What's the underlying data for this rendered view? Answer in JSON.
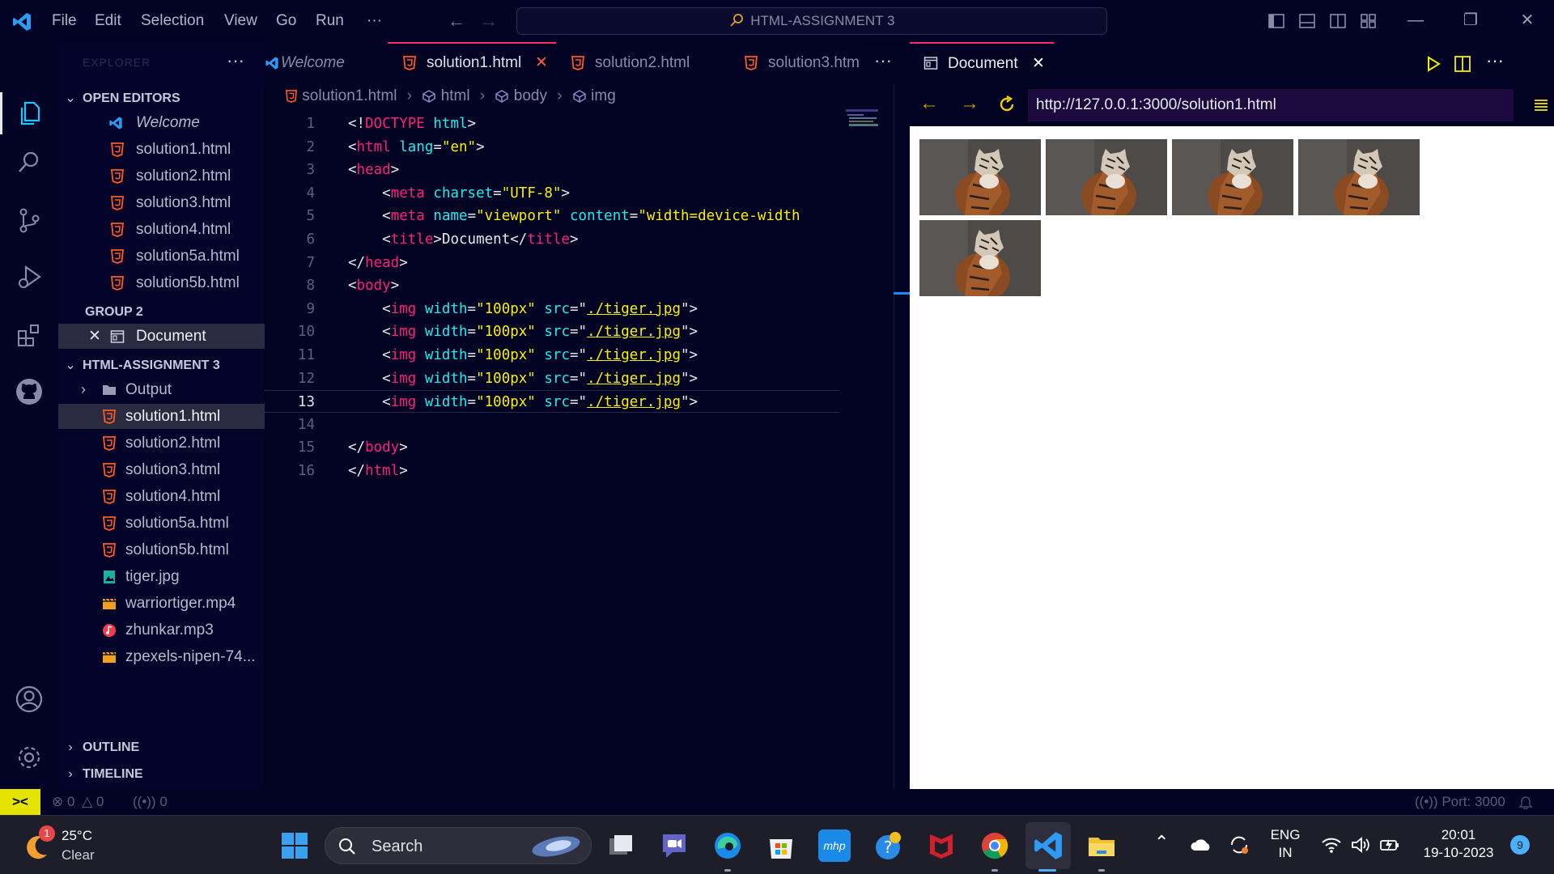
{
  "menu": [
    "File",
    "Edit",
    "Selection",
    "View",
    "Go",
    "Run",
    "···"
  ],
  "command_center": "HTML-ASSIGNMENT 3",
  "window_controls": {
    "minimize": "—",
    "restore": "❐",
    "close": "✕"
  },
  "sidebar": {
    "title": "EXPLORER",
    "more": "···",
    "open_editors_header": "OPEN EDITORS",
    "open_editors": [
      "Welcome",
      "solution1.html",
      "solution2.html",
      "solution3.html",
      "solution4.html",
      "solution5a.html",
      "solution5b.html"
    ],
    "group_header": "GROUP 2",
    "group_item": "Document",
    "folder_header": "HTML-ASSIGNMENT 3",
    "folder_items": [
      "Output",
      "solution1.html",
      "solution2.html",
      "solution3.html",
      "solution4.html",
      "solution5a.html",
      "solution5b.html",
      "tiger.jpg",
      "warriortiger.mp4",
      "zhunkar.mp3",
      "zpexels-nipen-74..."
    ],
    "outline_header": "OUTLINE",
    "timeline_header": "TIMELINE"
  },
  "tabs": [
    "Welcome",
    "solution1.html",
    "solution2.html",
    "solution3.htm"
  ],
  "tab_close": "✕",
  "tabs_more": "···",
  "breadcrumb": [
    "solution1.html",
    "html",
    "body",
    "img"
  ],
  "code": {
    "line_numbers": [
      "1",
      "2",
      "3",
      "4",
      "5",
      "6",
      "7",
      "8",
      "9",
      "10",
      "11",
      "12",
      "13",
      "14",
      "15",
      "16"
    ],
    "doctype": "DOCTYPE",
    "html": "html",
    "head": "head",
    "meta": "meta",
    "title": "title",
    "body": "body",
    "img": "img",
    "lang": "lang",
    "en": "\"en\"",
    "charset": "charset",
    "utf8": "\"UTF-8\"",
    "name": "name",
    "viewport": "\"viewport\"",
    "content": "content",
    "content_val": "\"width=device-width",
    "width": "width",
    "width_val": "\"100px\"",
    "src": "src",
    "src_val": "./tiger.jpg",
    "document": "Document"
  },
  "preview": {
    "tab_title": "Document",
    "url": "http://127.0.0.1:3000/solution1.html",
    "more": "···"
  },
  "statusbar": {
    "errors": "0",
    "warnings": "0",
    "ports": "0",
    "port_label": "Port: 3000"
  },
  "taskbar": {
    "weather_temp": "25°C",
    "weather_desc": "Clear",
    "weather_badge": "1",
    "search": "Search",
    "lang_top": "ENG",
    "lang_bottom": "IN",
    "time": "20:01",
    "date": "19-10-2023",
    "notifications": "9",
    "mcafee": "mhp"
  }
}
